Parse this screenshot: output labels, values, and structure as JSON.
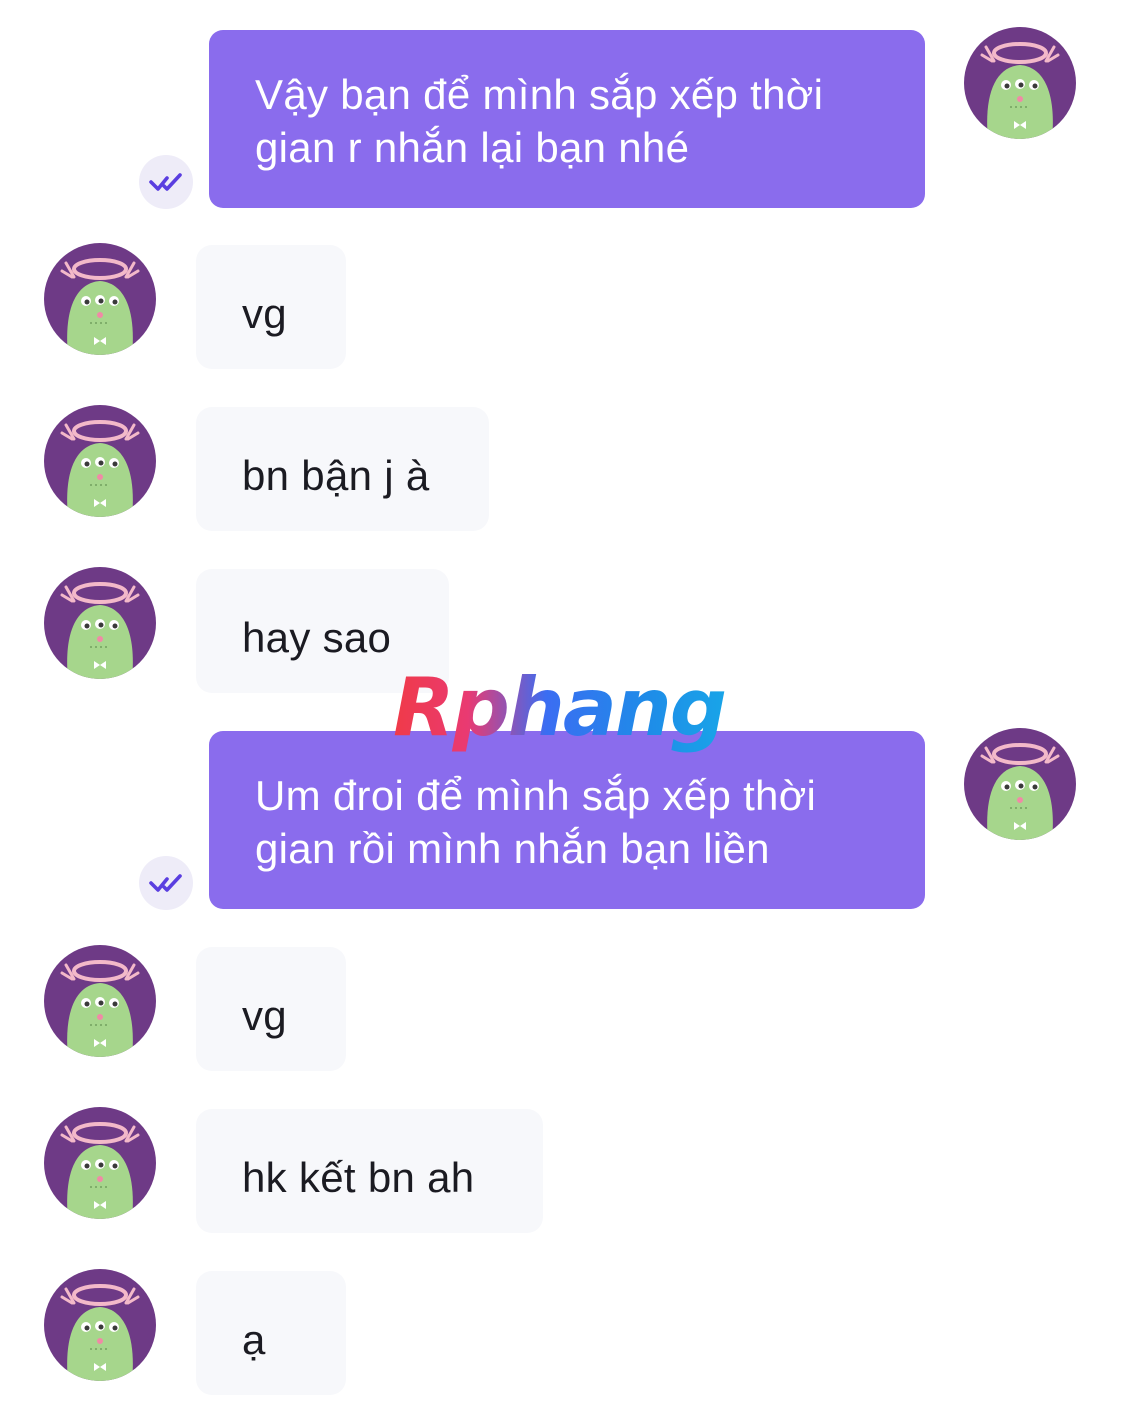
{
  "messages": [
    {
      "direction": "outgoing",
      "text": "Vậy bạn để mình sắp xếp thời gian r nhắn lại bạn nhé",
      "status_icon": "double-check-icon"
    },
    {
      "direction": "incoming",
      "text": "vg"
    },
    {
      "direction": "incoming",
      "text": "bn bận j à"
    },
    {
      "direction": "incoming",
      "text": "hay sao"
    },
    {
      "direction": "outgoing",
      "text": "Um đroi để mình sắp xếp thời gian rồi mình nhắn bạn liền",
      "status_icon": "double-check-icon"
    },
    {
      "direction": "incoming",
      "text": "vg"
    },
    {
      "direction": "incoming",
      "text": "hk kết bn ah"
    },
    {
      "direction": "incoming",
      "text": "ạ"
    }
  ],
  "watermark": {
    "text": "Rphang"
  },
  "colors": {
    "outgoing_bubble": "#8a6ced",
    "incoming_bubble": "#f7f8fb",
    "avatar_ring": "#6e3a86",
    "avatar_monster": "#a6d68c"
  },
  "avatar_icon": "green-monster-avatar-icon"
}
